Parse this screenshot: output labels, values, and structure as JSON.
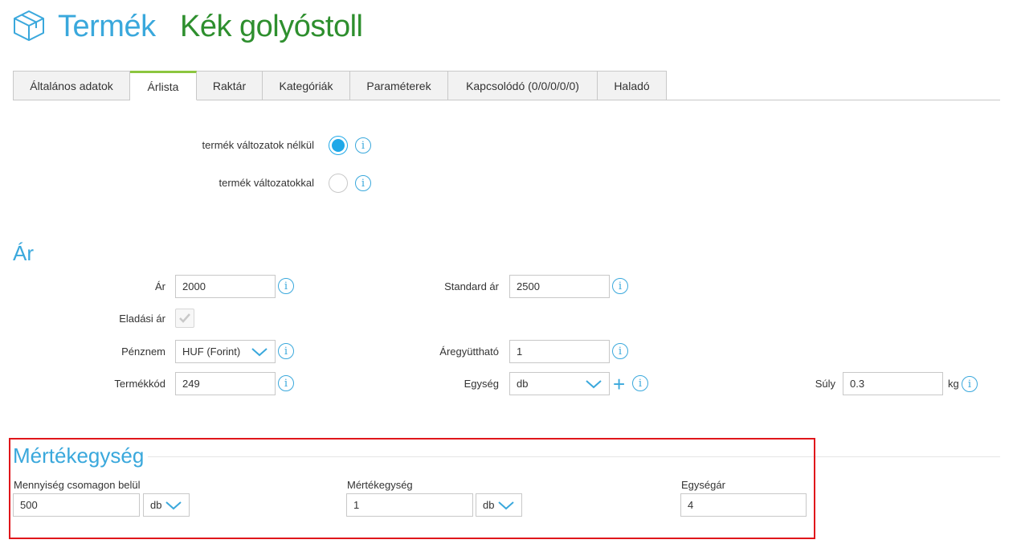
{
  "header": {
    "icon": "box-icon",
    "title": "Termék",
    "product_name": "Kék golyóstoll"
  },
  "tabs": [
    {
      "label": "Általános adatok",
      "active": false
    },
    {
      "label": "Árlista",
      "active": true
    },
    {
      "label": "Raktár",
      "active": false
    },
    {
      "label": "Kategóriák",
      "active": false
    },
    {
      "label": "Paraméterek",
      "active": false
    },
    {
      "label": "Kapcsolódó (0/0/0/0/0)",
      "active": false
    },
    {
      "label": "Haladó",
      "active": false
    }
  ],
  "variants": {
    "without_label": "termék változatok nélkül",
    "with_label": "termék változatokkal",
    "selected": "without"
  },
  "price_section": {
    "title": "Ár",
    "price_label": "Ár",
    "price_value": "2000",
    "standard_price_label": "Standard ár",
    "standard_price_value": "2500",
    "sale_price_label": "Eladási ár",
    "currency_label": "Pénznem",
    "currency_value": "HUF (Forint)",
    "price_factor_label": "Áregyüttható",
    "price_factor_value": "1",
    "product_code_label": "Termékkód",
    "product_code_value": "249",
    "unit_label": "Egység",
    "unit_value": "db",
    "weight_label": "Súly",
    "weight_value": "0.3",
    "weight_unit": "kg"
  },
  "measure_section": {
    "title": "Mértékegység",
    "qty_label": "Mennyiség csomagon belül",
    "qty_value": "500",
    "qty_unit": "db",
    "measure_label": "Mértékegység",
    "measure_value": "1",
    "measure_unit": "db",
    "unit_price_label": "Egységár",
    "unit_price_value": "4"
  },
  "colors": {
    "accent_blue": "#3aa8dc",
    "product_green": "#2e8f2e",
    "active_tab_green": "#8cc63f",
    "highlight_red": "#e0161b"
  }
}
